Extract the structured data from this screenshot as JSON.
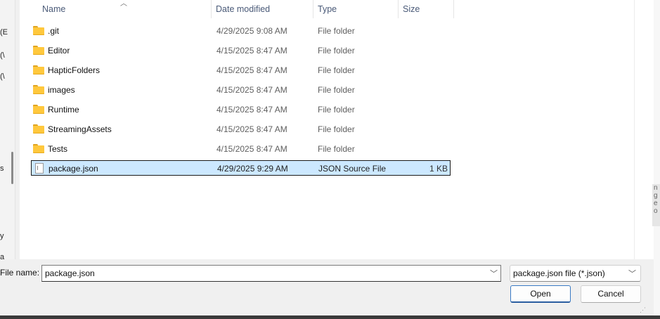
{
  "nav_fragments": [
    "(E",
    "(\\",
    "(\\",
    "s",
    "y",
    "a"
  ],
  "columns": {
    "name": "Name",
    "date": "Date modified",
    "type": "Type",
    "size": "Size"
  },
  "files": [
    {
      "name": ".git",
      "date": "4/29/2025 9:08 AM",
      "type": "File folder",
      "size": "",
      "icon": "folder-icon"
    },
    {
      "name": "Editor",
      "date": "4/15/2025 8:47 AM",
      "type": "File folder",
      "size": "",
      "icon": "folder-icon"
    },
    {
      "name": "HapticFolders",
      "date": "4/15/2025 8:47 AM",
      "type": "File folder",
      "size": "",
      "icon": "folder-icon"
    },
    {
      "name": "images",
      "date": "4/15/2025 8:47 AM",
      "type": "File folder",
      "size": "",
      "icon": "folder-icon"
    },
    {
      "name": "Runtime",
      "date": "4/15/2025 8:47 AM",
      "type": "File folder",
      "size": "",
      "icon": "folder-icon"
    },
    {
      "name": "StreamingAssets",
      "date": "4/15/2025 8:47 AM",
      "type": "File folder",
      "size": "",
      "icon": "folder-icon"
    },
    {
      "name": "Tests",
      "date": "4/15/2025 8:47 AM",
      "type": "File folder",
      "size": "",
      "icon": "folder-icon"
    },
    {
      "name": "package.json",
      "date": "4/29/2025 9:29 AM",
      "type": "JSON Source File",
      "size": "1 KB",
      "icon": "file-icon",
      "selected": true
    }
  ],
  "bottom": {
    "file_name_label": "File name:",
    "file_name_value": "package.json",
    "filter_value": "package.json file (*.json)",
    "open_label": "Open",
    "cancel_label": "Cancel"
  },
  "right_fragments": [
    "n",
    "g",
    "e",
    "o"
  ],
  "colors": {
    "selection_bg": "#cce8ff",
    "folder_yellow": "#ffc83d",
    "header_text": "#4a5a78",
    "open_border": "#3a7ac4"
  }
}
